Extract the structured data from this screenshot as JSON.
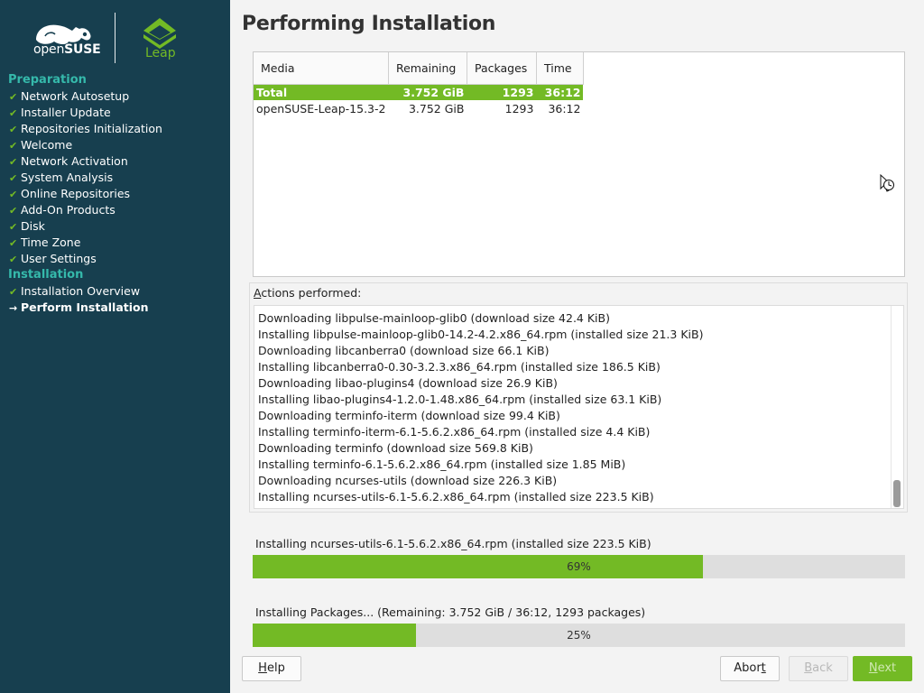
{
  "window": {
    "title": "Performing Installation"
  },
  "branding": {
    "suse_text_light": "open",
    "suse_text_bold": "SUSE",
    "leap_text": "Leap"
  },
  "sidebar": {
    "sections": [
      {
        "title": "Preparation",
        "items": [
          {
            "label": "Network Autosetup",
            "state": "done"
          },
          {
            "label": "Installer Update",
            "state": "done"
          },
          {
            "label": "Repositories Initialization",
            "state": "done"
          },
          {
            "label": "Welcome",
            "state": "done"
          },
          {
            "label": "Network Activation",
            "state": "done"
          },
          {
            "label": "System Analysis",
            "state": "done"
          },
          {
            "label": "Online Repositories",
            "state": "done"
          },
          {
            "label": "Add-On Products",
            "state": "done"
          },
          {
            "label": "Disk",
            "state": "done"
          },
          {
            "label": "Time Zone",
            "state": "done"
          },
          {
            "label": "User Settings",
            "state": "done"
          }
        ]
      },
      {
        "title": "Installation",
        "items": [
          {
            "label": "Installation Overview",
            "state": "done"
          },
          {
            "label": "Perform Installation",
            "state": "current"
          }
        ]
      }
    ],
    "done_mark": "✔",
    "current_mark": "→"
  },
  "media_table": {
    "headers": [
      "Media",
      "Remaining",
      "Packages",
      "Time"
    ],
    "rows": [
      {
        "media": "Total",
        "remaining": "3.752 GiB",
        "packages": "1293",
        "time": "36:12",
        "selected": true
      },
      {
        "media": "openSUSE-Leap-15.3-2",
        "remaining": "3.752 GiB",
        "packages": "1293",
        "time": "36:12",
        "selected": false
      }
    ]
  },
  "actions": {
    "label_prefix": "A",
    "label_rest": "ctions performed:",
    "lines": [
      "Downloading libpulse-mainloop-glib0 (download size 42.4 KiB)",
      "Installing libpulse-mainloop-glib0-14.2-4.2.x86_64.rpm (installed size 21.3 KiB)",
      "Downloading libcanberra0 (download size 66.1 KiB)",
      "Installing libcanberra0-0.30-3.2.3.x86_64.rpm (installed size 186.5 KiB)",
      "Downloading libao-plugins4 (download size 26.9 KiB)",
      "Installing libao-plugins4-1.2.0-1.48.x86_64.rpm (installed size 63.1 KiB)",
      "Downloading terminfo-iterm (download size 99.4 KiB)",
      "Installing terminfo-iterm-6.1-5.6.2.x86_64.rpm (installed size 4.4 KiB)",
      "Downloading terminfo (download size 569.8 KiB)",
      "Installing terminfo-6.1-5.6.2.x86_64.rpm (installed size 1.85 MiB)",
      "Downloading ncurses-utils (download size 226.3 KiB)",
      "Installing ncurses-utils-6.1-5.6.2.x86_64.rpm (installed size 223.5 KiB)"
    ]
  },
  "package_progress": {
    "label": "Installing ncurses-utils-6.1-5.6.2.x86_64.rpm (installed size 223.5 KiB)",
    "percent": 69,
    "percent_text": "69%"
  },
  "total_progress": {
    "label": "Installing Packages... (Remaining: 3.752 GiB / 36:12, 1293 packages)",
    "percent": 25,
    "percent_text": "25%"
  },
  "buttons": {
    "help_prefix": "H",
    "help_rest": "elp",
    "abort_prefix": "Abor",
    "abort_ul": "t",
    "abort_rest": "",
    "back_prefix": "B",
    "back_rest": "ack",
    "next_prefix": "N",
    "next_rest": "ext"
  },
  "colors": {
    "accent": "#73ba25",
    "sidebar_bg": "#173f4f",
    "section_title": "#35b9ab"
  }
}
